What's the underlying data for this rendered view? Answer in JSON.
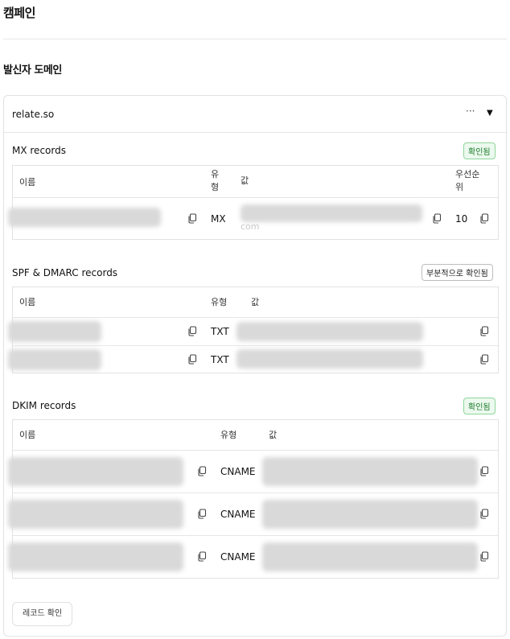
{
  "page": {
    "title": "캠페인"
  },
  "sender": {
    "section_title": "발신자 도메인",
    "domain": "relate.so",
    "more_label": "···",
    "caret_label": "▼",
    "verify_button": "레코드 확인"
  },
  "mx": {
    "title": "MX records",
    "status": "확인됨",
    "headers": {
      "name": "이름",
      "type_line1": "유",
      "type_line2": "형",
      "value": "값",
      "priority_line1": "우선순",
      "priority_line2": "위"
    },
    "row": {
      "type": "MX",
      "value_tail": "com",
      "priority": "10"
    }
  },
  "spf": {
    "title": "SPF & DMARC records",
    "status": "부분적으로 확인됨",
    "headers": {
      "name": "이름",
      "type": "유형",
      "value": "값"
    },
    "rows": [
      {
        "type": "TXT"
      },
      {
        "type": "TXT"
      }
    ]
  },
  "dkim": {
    "title": "DKIM records",
    "status": "확인됨",
    "headers": {
      "name": "이름",
      "type": "유형",
      "value": "값"
    },
    "rows": [
      {
        "type": "CNAME"
      },
      {
        "type": "CNAME"
      },
      {
        "type": "CNAME"
      }
    ]
  },
  "icons": {
    "copy": "copy-icon",
    "more": "more-icon",
    "caret": "caret-down-icon"
  },
  "colors": {
    "verified_text": "#1c7c2c",
    "verified_border": "#8fd69b",
    "verified_bg": "#ecf9ee",
    "border": "#e2e2e2"
  }
}
